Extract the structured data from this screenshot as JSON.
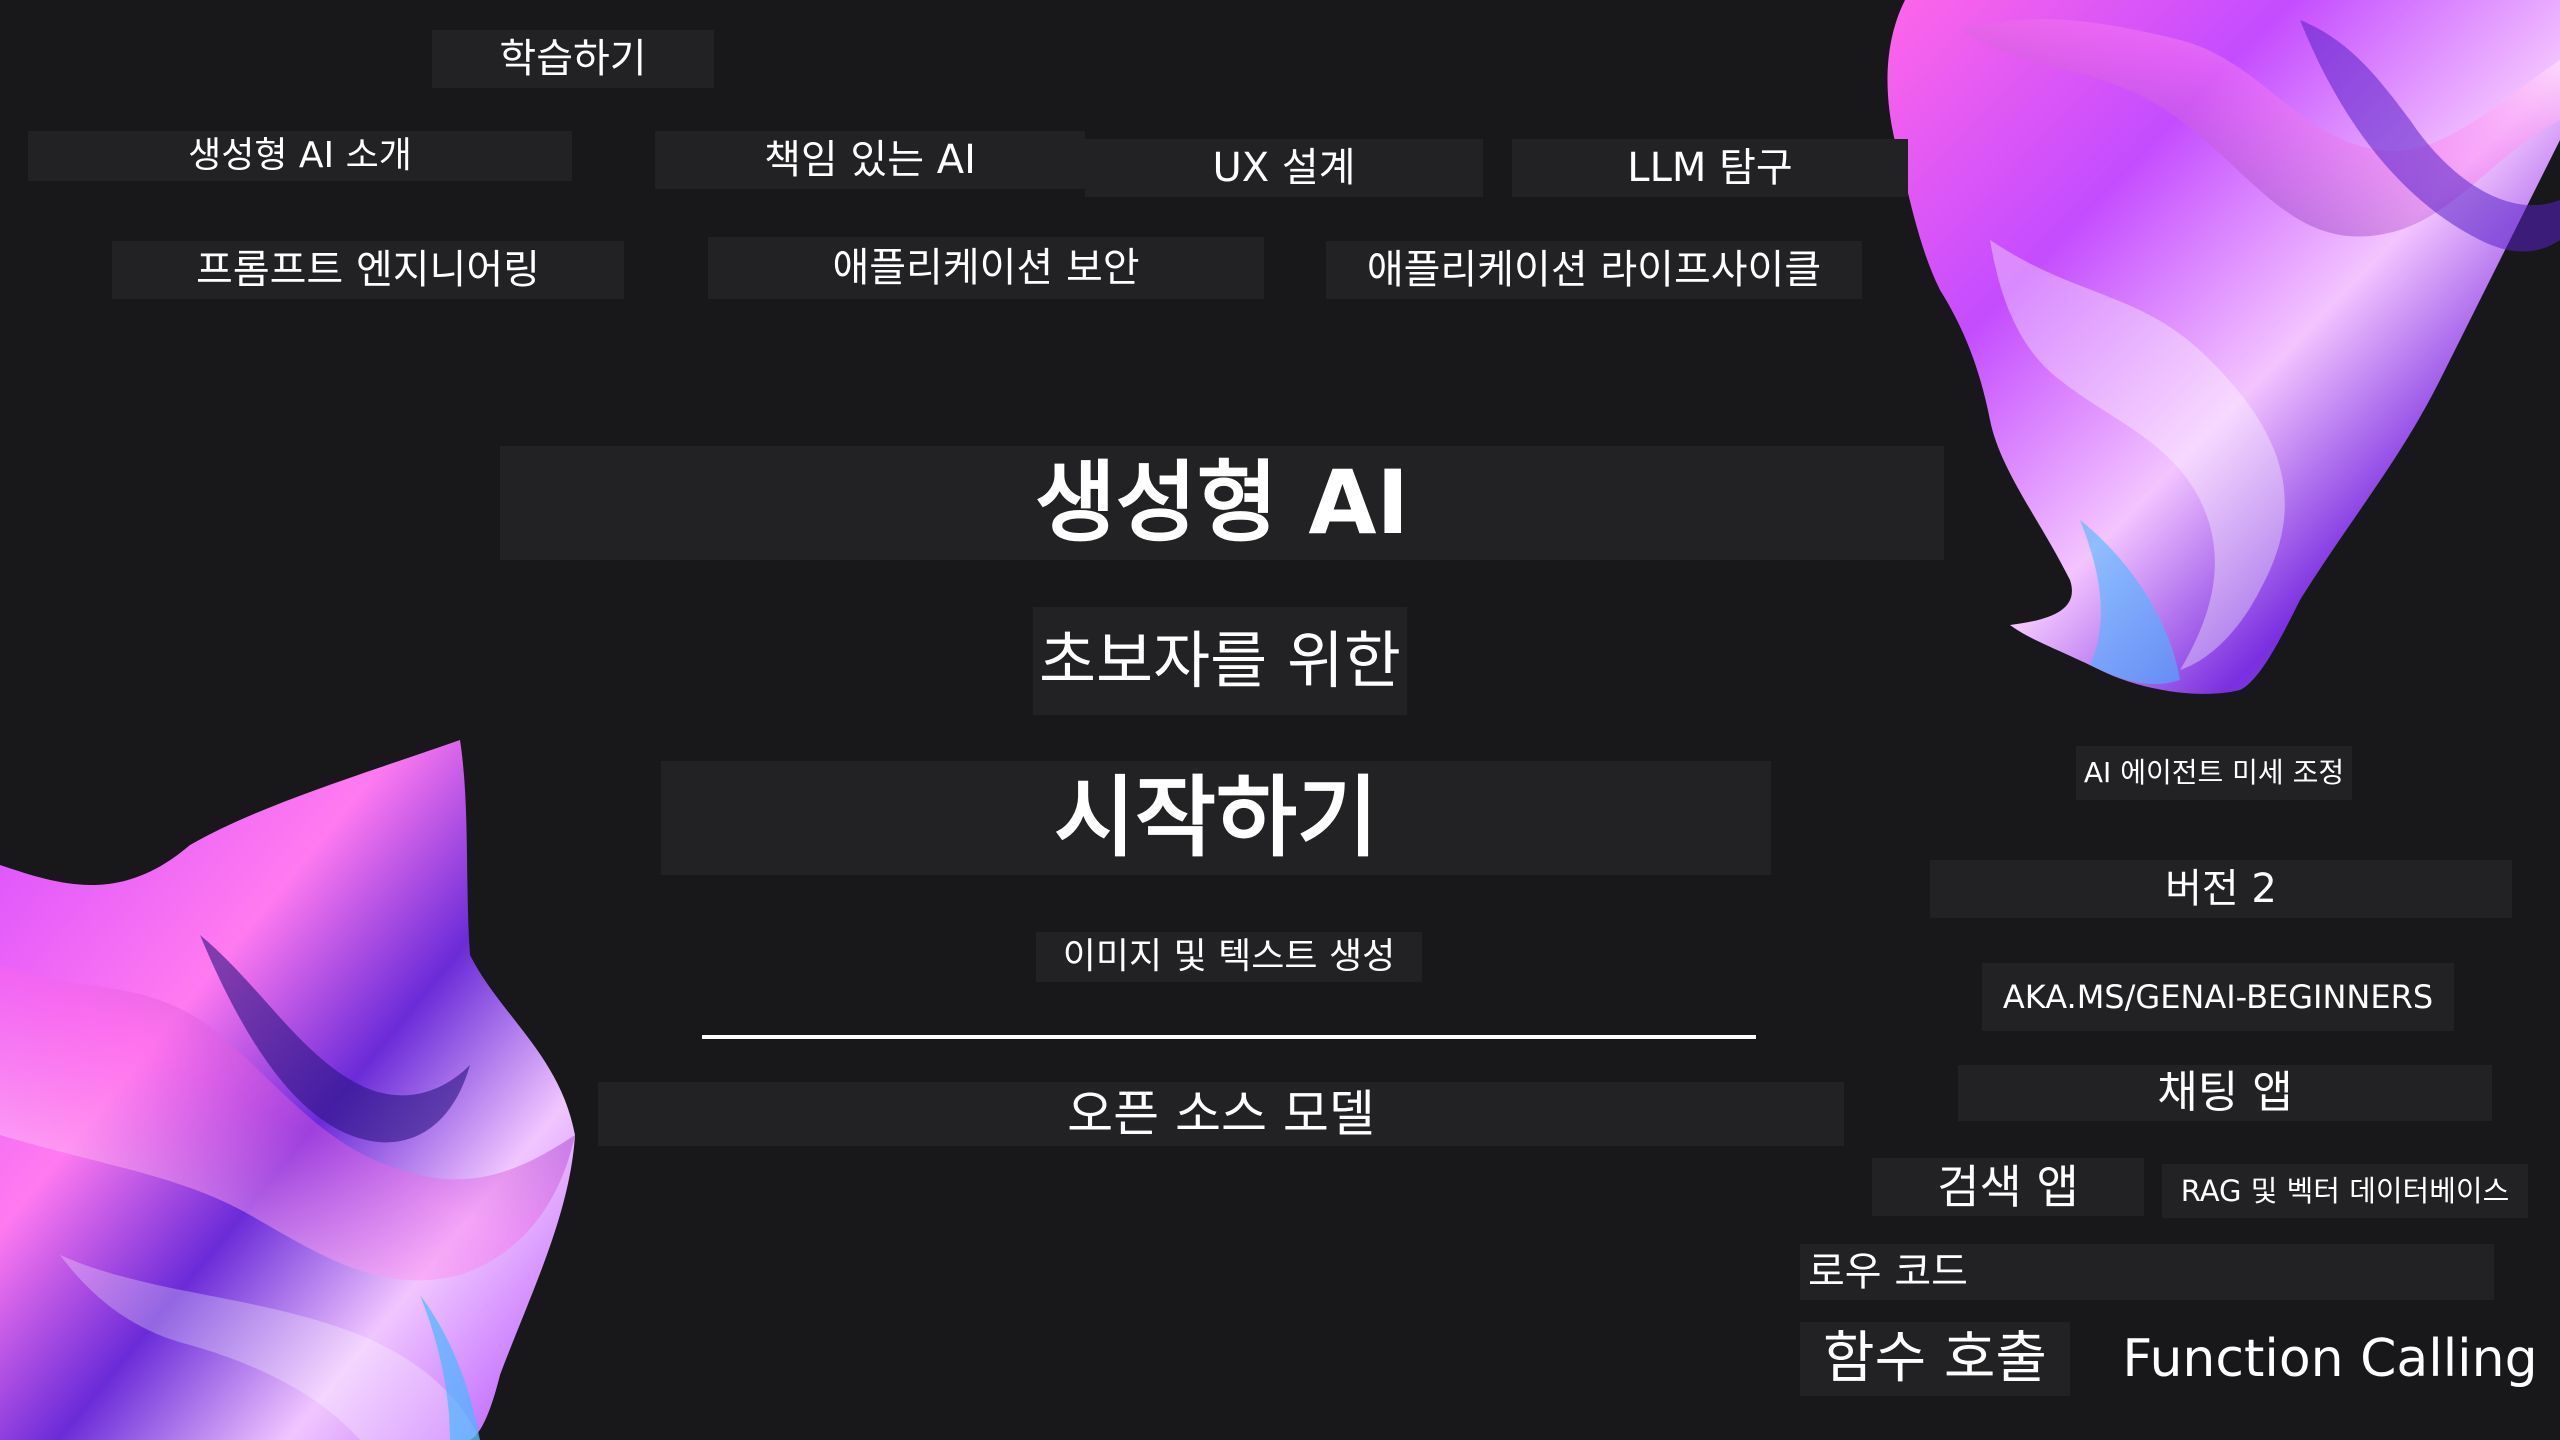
{
  "page": {
    "background": "#18181a",
    "label_background": "#222224",
    "text_color": "#ffffff",
    "accent_colors": [
      "#ff5ce6",
      "#b04bff",
      "#6a2bd8",
      "#4fb4ff",
      "#ffd6fb"
    ]
  },
  "header": {
    "title": "학습하기"
  },
  "topics": {
    "row1": [
      "생성형 AI 소개",
      "책임 있는 AI",
      "UX 설계",
      "LLM 탐구"
    ],
    "row2": [
      "프롬프트 엔지니어링",
      "애플리케이션 보안",
      "애플리케이션 라이프사이클"
    ]
  },
  "hero": {
    "title": "생성형 AI",
    "subtitle": "초보자를 위한",
    "headline": "시작하기",
    "tagline": "이미지 및 텍스트 생성",
    "section": "오픈 소스 모델"
  },
  "right_panel": {
    "fine_tuning": "AI 에이전트 미세 조정",
    "version": "버전 2",
    "link": "AKA.MS/GENAI-BEGINNERS",
    "chat_app": "채팅 앱",
    "search_app": "검색 앱",
    "rag": "RAG 및 벡터 데이터베이스",
    "low_code": "로우 코드",
    "function_calling_ko": "함수 호출",
    "function_calling_en": "Function Calling"
  },
  "decor": {
    "top_right_art": "abstract-fabric-icon",
    "bottom_left_art": "abstract-fabric-icon"
  }
}
